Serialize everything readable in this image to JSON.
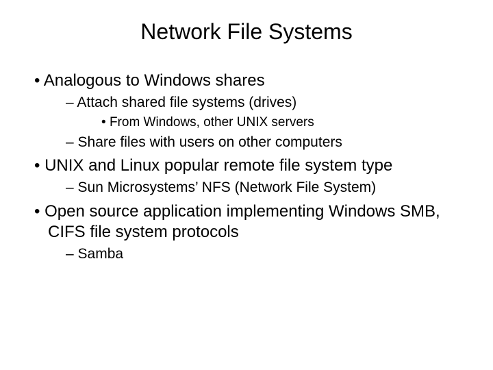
{
  "title": "Network File Systems",
  "body": {
    "b1": "Analogous to Windows shares",
    "b1_1": "Attach shared file systems (drives)",
    "b1_1_1": "From Windows, other UNIX servers",
    "b1_2": "Share files with users on other computers",
    "b2": "UNIX and Linux popular remote file system type",
    "b2_1": "Sun Microsystems’ NFS (Network File System)",
    "b3": "Open source application implementing Windows SMB, CIFS file system protocols",
    "b3_1": "Samba"
  }
}
